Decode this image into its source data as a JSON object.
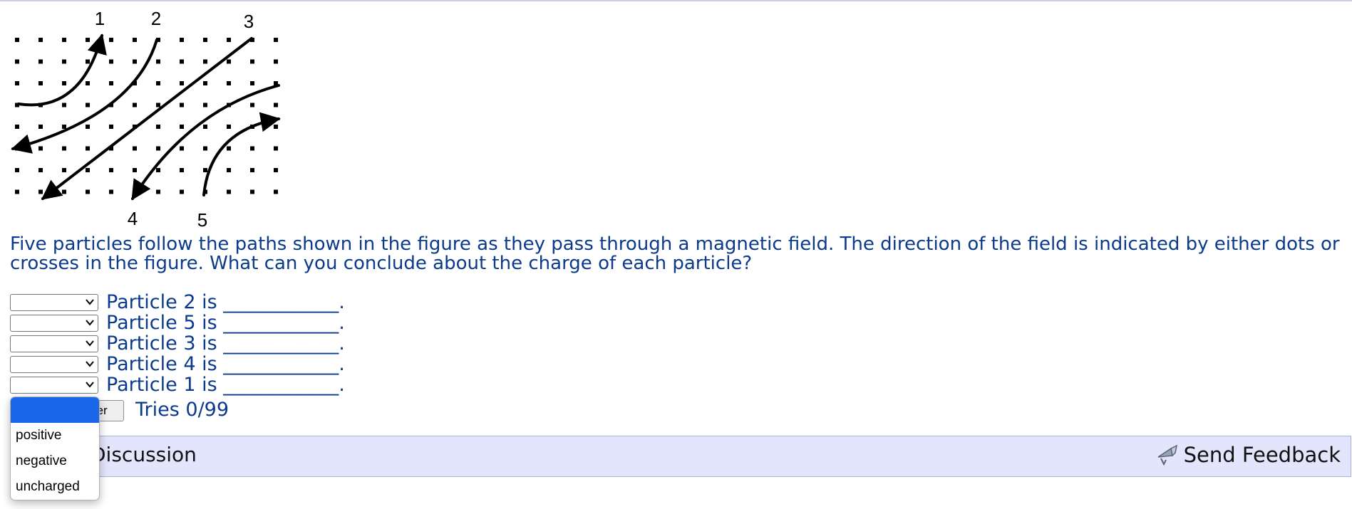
{
  "figure": {
    "path_labels": [
      "1",
      "2",
      "3",
      "4",
      "5"
    ],
    "field_marker": "dots"
  },
  "question": {
    "prompt": "Five particles follow the paths shown in the figure as they pass through a magnetic field. The direction of the field is indicated by either dots or crosses in the figure. What can you conclude about the charge of each particle?",
    "rows": [
      {
        "label": "Particle 2 is ____________.",
        "value": ""
      },
      {
        "label": "Particle 5 is ____________.",
        "value": ""
      },
      {
        "label": "Particle 3 is ____________.",
        "value": ""
      },
      {
        "label": "Particle 4 is ____________.",
        "value": ""
      },
      {
        "label": "Particle 1 is ____________.",
        "value": ""
      }
    ],
    "options": [
      "",
      "positive",
      "negative",
      "uncharged"
    ]
  },
  "submit": {
    "label": "Submit Answer",
    "tries": "Tries 0/99"
  },
  "footer": {
    "discussion_label": "Discussion",
    "feedback_label": "Send Feedback",
    "feedback_icon": "feedback-icon"
  },
  "colors": {
    "text": "#0b3a8c",
    "bar": "#e3e5fc",
    "dropdown_highlight": "#1a66e8"
  }
}
